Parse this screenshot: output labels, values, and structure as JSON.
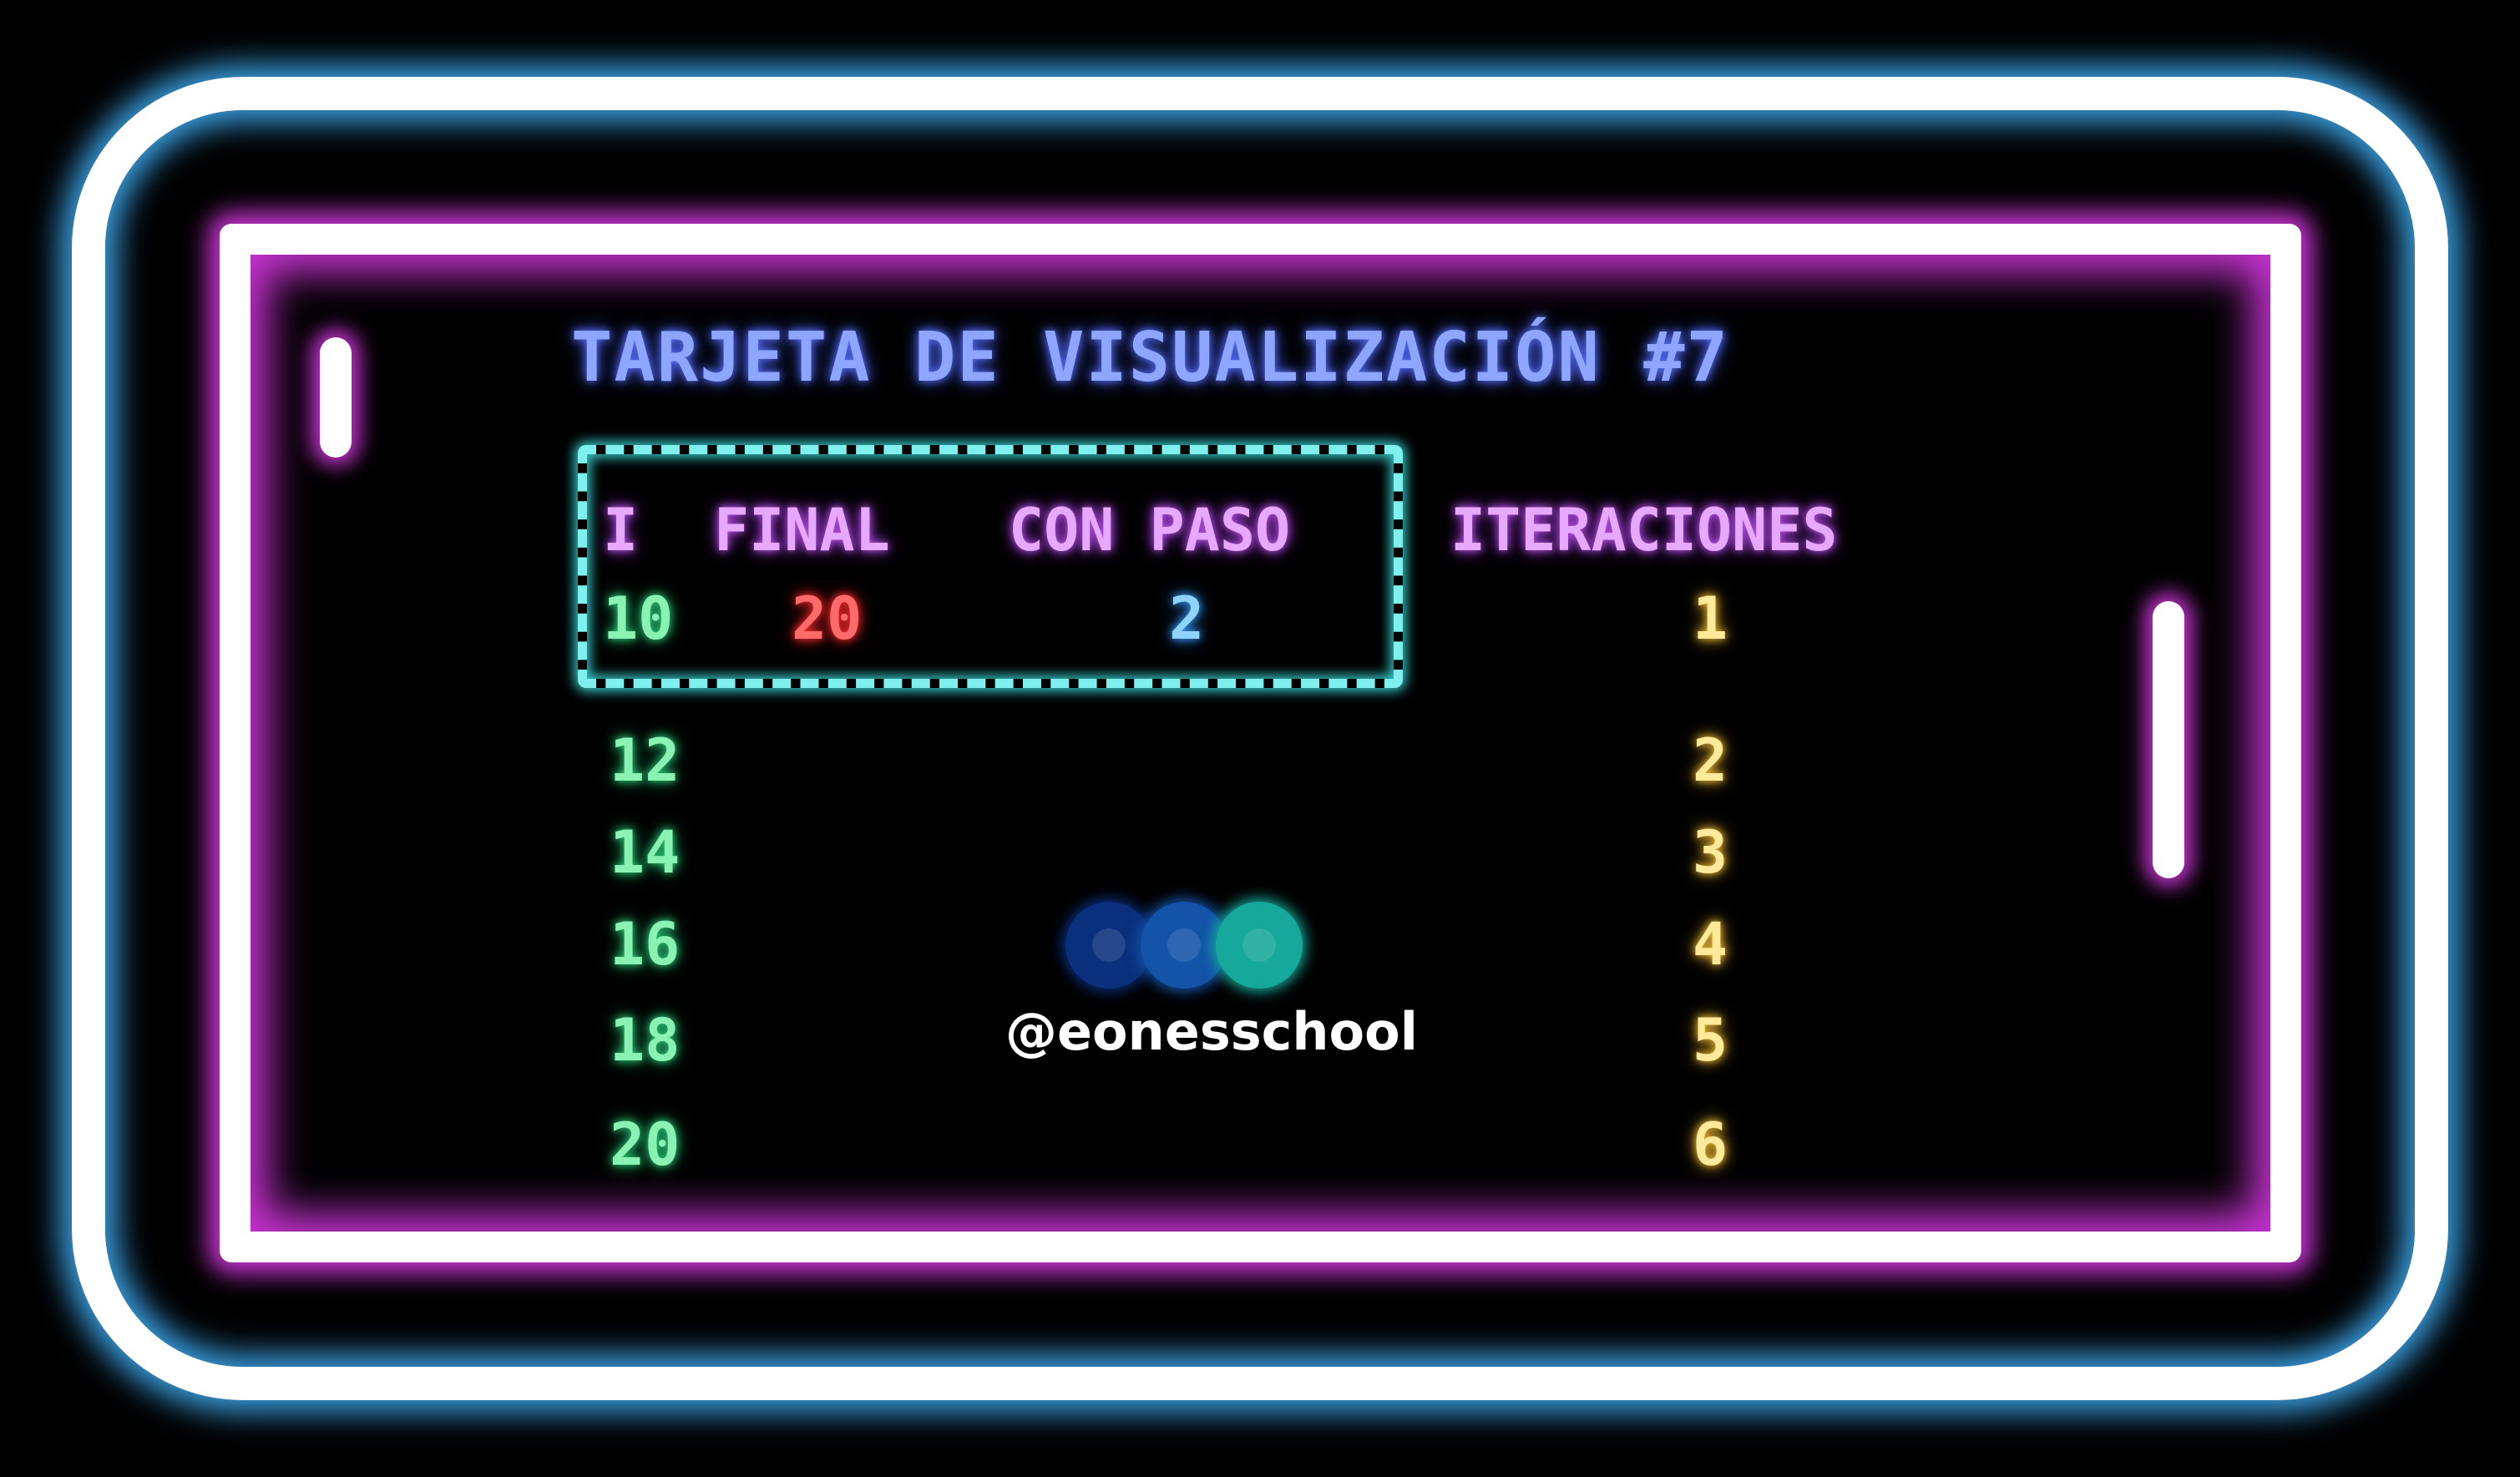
{
  "title": "TARJETA DE VISUALIZACIÓN #7",
  "headers": {
    "i": "I",
    "final": "FINAL",
    "paso": "CON PASO",
    "iteraciones": "ITERACIONES"
  },
  "params": {
    "i": "10",
    "final": "20",
    "paso": "2"
  },
  "rows": [
    {
      "i": "10",
      "iter": "1"
    },
    {
      "i": "12",
      "iter": "2"
    },
    {
      "i": "14",
      "iter": "3"
    },
    {
      "i": "16",
      "iter": "4"
    },
    {
      "i": "18",
      "iter": "5"
    },
    {
      "i": "20",
      "iter": "6"
    }
  ],
  "logo": {
    "handle": "@eonesschool"
  },
  "colors": {
    "outer_glow": "#3aa3e6",
    "inner_glow": "#c533d0",
    "title": "#8ea6ff",
    "header": "#e7a9ff",
    "i_values": "#8af2b3",
    "final_value": "#ff6a6a",
    "paso_value": "#8fd3ff",
    "iteration_values": "#ffe99a",
    "param_box": "#7ff0ee"
  }
}
